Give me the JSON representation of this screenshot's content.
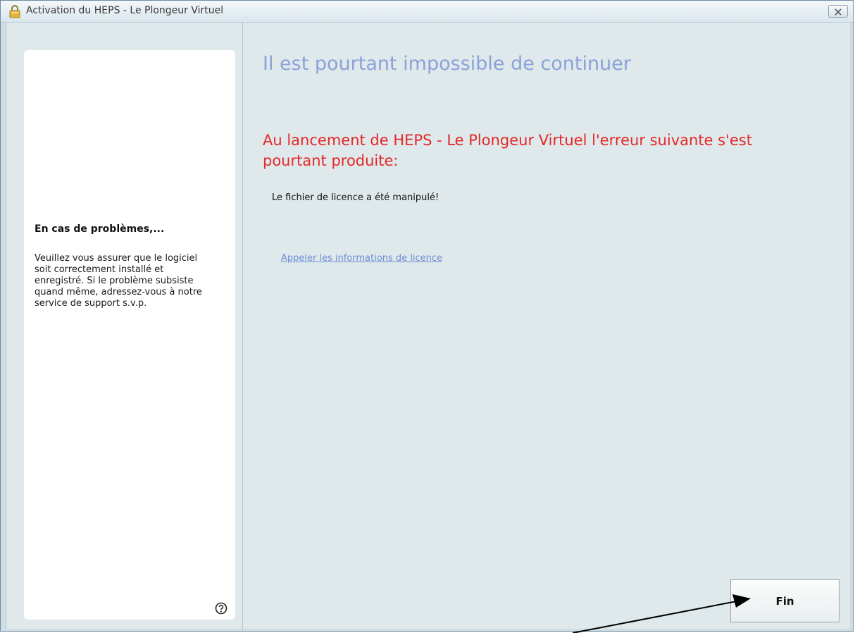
{
  "window": {
    "title": "Activation du HEPS - Le Plongeur Virtuel",
    "title_icon": "lock-icon",
    "close_icon": "close-icon"
  },
  "sidebar": {
    "heading": "En cas de problèmes,...",
    "body": "Veuillez vous assurer que le logiciel\nsoit correctement installé et\nenregistré. Si le problème subsiste\nquand même, adressez-vous à notre\nservice de support s.v.p.",
    "help_icon": "help-icon"
  },
  "main": {
    "title": "Il est pourtant impossible de continuer",
    "error_heading": "Au lancement de HEPS - Le Plongeur Virtuel l'erreur suivante s'est pourtant produite:",
    "error_message": "Le fichier de licence a été manipulé!",
    "license_link": "Appeler les informations de licence"
  },
  "footer": {
    "finish_label": "Fin"
  },
  "colors": {
    "title_blue": "#8aa2d8",
    "error_red": "#e42828",
    "link_blue": "#6f8fd6"
  }
}
